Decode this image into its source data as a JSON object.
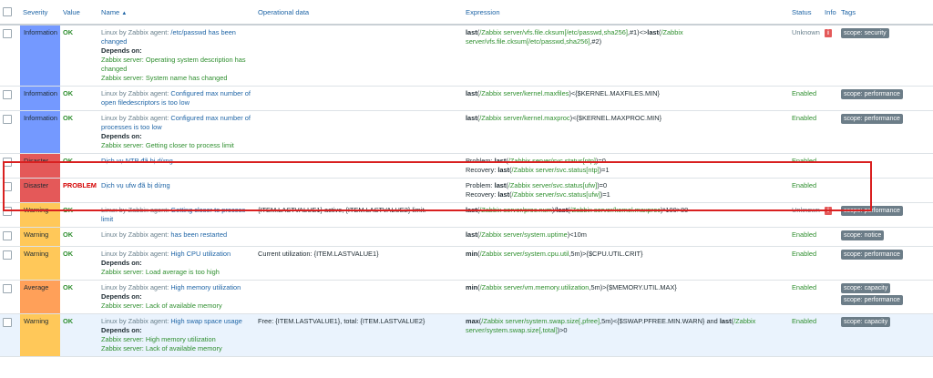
{
  "columns": {
    "severity": "Severity",
    "value": "Value",
    "name": "Name",
    "sort_icon": "▲",
    "operational": "Operational data",
    "expression": "Expression",
    "status": "Status",
    "info": "Info",
    "tags": "Tags"
  },
  "labels": {
    "depends_on": "Depends on:"
  },
  "colors": {
    "information": "#7499ff",
    "disaster": "#e45959",
    "warning": "#ffc859",
    "average": "#ffa059",
    "ok": "#2f8f2f",
    "problem": "#d40000"
  },
  "rows": [
    {
      "severity": "Information",
      "sev_class": "info",
      "value": "OK",
      "host": "Linux by Zabbix agent: ",
      "name": "/etc/passwd has been changed",
      "depends": [
        "Zabbix server: Operating system description has changed",
        "Zabbix server: System name has changed"
      ],
      "operational": "",
      "expr_parts": [
        [
          "b",
          "last"
        ],
        [
          "t",
          "("
        ],
        [
          "f",
          "/Zabbix server/vfs.file.cksum[/etc/passwd,sha256]"
        ],
        [
          "t",
          ",#1)<>"
        ],
        [
          "b",
          "last"
        ],
        [
          "t",
          "("
        ],
        [
          "f",
          "/Zabbix server/vfs.file.cksum[/etc/passwd,sha256]"
        ],
        [
          "t",
          ",#2)"
        ]
      ],
      "status": "Unknown",
      "info": "i",
      "tags": [
        "scope: security"
      ]
    },
    {
      "severity": "Information",
      "sev_class": "info",
      "value": "OK",
      "host": "Linux by Zabbix agent: ",
      "name": "Configured max number of open filedescriptors is too low",
      "depends": [],
      "operational": "",
      "expr_parts": [
        [
          "b",
          "last"
        ],
        [
          "t",
          "("
        ],
        [
          "f",
          "/Zabbix server/kernel.maxfiles"
        ],
        [
          "t",
          ")<{$KERNEL.MAXFILES.MIN}"
        ]
      ],
      "status": "Enabled",
      "info": "",
      "tags": [
        "scope: performance"
      ]
    },
    {
      "severity": "Information",
      "sev_class": "info",
      "value": "OK",
      "host": "Linux by Zabbix agent: ",
      "name": "Configured max number of processes is too low",
      "depends": [
        "Zabbix server: Getting closer to process limit"
      ],
      "operational": "",
      "expr_parts": [
        [
          "b",
          "last"
        ],
        [
          "t",
          "("
        ],
        [
          "f",
          "/Zabbix server/kernel.maxproc"
        ],
        [
          "t",
          ")<{$KERNEL.MAXPROC.MIN}"
        ]
      ],
      "status": "Enabled",
      "info": "",
      "tags": [
        "scope: performance"
      ]
    },
    {
      "severity": "Disaster",
      "sev_class": "disaster",
      "value": "OK",
      "host": "",
      "name": "Dịch vụ NTP đã bị dừng",
      "depends": [],
      "operational": "",
      "expr_parts": [
        [
          "t",
          "Problem: "
        ],
        [
          "b",
          "last"
        ],
        [
          "t",
          "("
        ],
        [
          "f",
          "/Zabbix server/svc.status[ntp]"
        ],
        [
          "t",
          ")=0"
        ],
        [
          "br",
          ""
        ],
        [
          "t",
          "Recovery: "
        ],
        [
          "b",
          "last"
        ],
        [
          "t",
          "("
        ],
        [
          "f",
          "/Zabbix server/svc.status[ntp]"
        ],
        [
          "t",
          ")=1"
        ]
      ],
      "status": "Enabled",
      "info": "",
      "tags": []
    },
    {
      "severity": "Disaster",
      "sev_class": "disaster",
      "value": "PROBLEM",
      "host": "",
      "name": "Dịch vụ ufw đã bị dừng",
      "depends": [],
      "operational": "",
      "expr_parts": [
        [
          "t",
          "Problem: "
        ],
        [
          "b",
          "last"
        ],
        [
          "t",
          "("
        ],
        [
          "f",
          "/Zabbix server/svc.status[ufw]"
        ],
        [
          "t",
          ")=0"
        ],
        [
          "br",
          ""
        ],
        [
          "t",
          "Recovery: "
        ],
        [
          "b",
          "last"
        ],
        [
          "t",
          "("
        ],
        [
          "f",
          "/Zabbix server/svc.status[ufw]"
        ],
        [
          "t",
          ")=1"
        ]
      ],
      "status": "Enabled",
      "info": "",
      "tags": []
    },
    {
      "severity": "Warning",
      "sev_class": "warning",
      "value": "OK",
      "host": "Linux by Zabbix agent: ",
      "name": "Getting closer to process limit",
      "depends": [],
      "operational": "{ITEM.LASTVALUE1} active, {ITEM.LASTVALUE2} limit.",
      "expr_parts": [
        [
          "b",
          "last"
        ],
        [
          "t",
          "("
        ],
        [
          "f",
          "/Zabbix server/proc.num"
        ],
        [
          "t",
          ")/"
        ],
        [
          "b",
          "last"
        ],
        [
          "t",
          "("
        ],
        [
          "f",
          "/Zabbix server/kernel.maxproc"
        ],
        [
          "t",
          ")*100>80"
        ]
      ],
      "status": "Unknown",
      "info": "i",
      "tags": [
        "scope: performance"
      ]
    },
    {
      "severity": "Warning",
      "sev_class": "warning",
      "value": "OK",
      "host": "Linux by Zabbix agent: ",
      "name": "has been restarted",
      "depends": [],
      "operational": "",
      "expr_parts": [
        [
          "b",
          "last"
        ],
        [
          "t",
          "("
        ],
        [
          "f",
          "/Zabbix server/system.uptime"
        ],
        [
          "t",
          ")<10m"
        ]
      ],
      "status": "Enabled",
      "info": "",
      "tags": [
        "scope: notice"
      ]
    },
    {
      "severity": "Warning",
      "sev_class": "warning",
      "value": "OK",
      "host": "Linux by Zabbix agent: ",
      "name": "High CPU utilization",
      "depends": [
        "Zabbix server: Load average is too high"
      ],
      "operational": "Current utilization: {ITEM.LASTVALUE1}",
      "expr_parts": [
        [
          "b",
          "min"
        ],
        [
          "t",
          "("
        ],
        [
          "f",
          "/Zabbix server/system.cpu.util"
        ],
        [
          "t",
          ",5m)>{$CPU.UTIL.CRIT}"
        ]
      ],
      "status": "Enabled",
      "info": "",
      "tags": [
        "scope: performance"
      ]
    },
    {
      "severity": "Average",
      "sev_class": "average",
      "value": "OK",
      "host": "Linux by Zabbix agent: ",
      "name": "High memory utilization",
      "depends": [
        "Zabbix server: Lack of available memory"
      ],
      "operational": "",
      "expr_parts": [
        [
          "b",
          "min"
        ],
        [
          "t",
          "("
        ],
        [
          "f",
          "/Zabbix server/vm.memory.utilization"
        ],
        [
          "t",
          ",5m)>{$MEMORY.UTIL.MAX}"
        ]
      ],
      "status": "Enabled",
      "info": "",
      "tags": [
        "scope: capacity",
        "scope: performance"
      ]
    },
    {
      "severity": "Warning",
      "sev_class": "warning",
      "value": "OK",
      "host": "Linux by Zabbix agent: ",
      "name": "High swap space usage",
      "depends": [
        "Zabbix server: High memory utilization",
        "Zabbix server: Lack of available memory"
      ],
      "operational": "Free: {ITEM.LASTVALUE1}, total: {ITEM.LASTVALUE2}",
      "expr_parts": [
        [
          "b",
          "max"
        ],
        [
          "t",
          "("
        ],
        [
          "f",
          "/Zabbix server/system.swap.size[,pfree]"
        ],
        [
          "t",
          ",5m)<{$SWAP.PFREE.MIN.WARN} and "
        ],
        [
          "b",
          "last"
        ],
        [
          "t",
          "("
        ],
        [
          "f",
          "/Zabbix server/system.swap.size[,total]"
        ],
        [
          "t",
          ")>0"
        ]
      ],
      "status": "Enabled",
      "info": "",
      "tags": [
        "scope: capacity"
      ],
      "highlight": true
    }
  ]
}
